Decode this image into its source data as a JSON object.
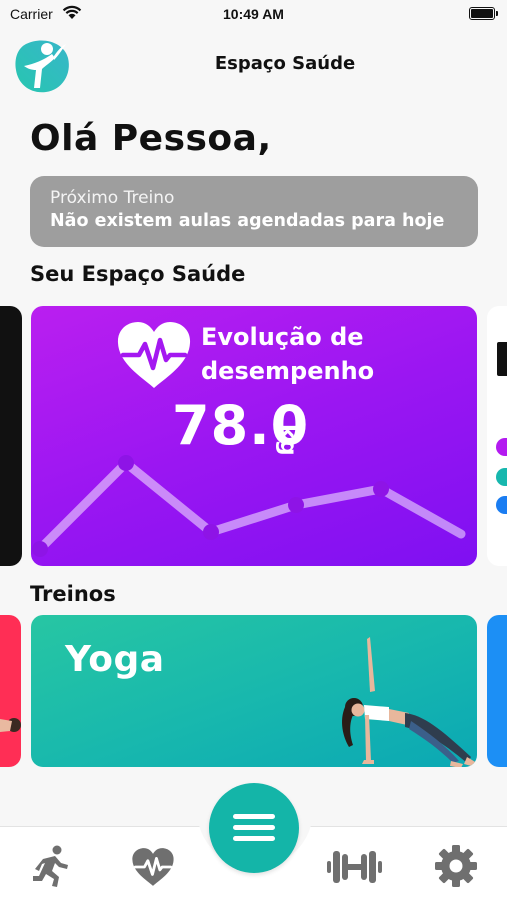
{
  "status_bar": {
    "carrier": "Carrier",
    "time": "10:49 AM"
  },
  "header": {
    "title": "Espaço Saúde"
  },
  "greeting": "Olá Pessoa,",
  "next_workout": {
    "label": "Próximo Treino",
    "message": "Não existem aulas agendadas para hoje"
  },
  "sections": {
    "space": "Seu Espaço Saúde",
    "workouts": "Treinos"
  },
  "performance_card": {
    "title_line1": "Evolução de",
    "title_line2": "desempenho",
    "value": "78.0",
    "unit": "kg",
    "icon": "heart-pulse-icon"
  },
  "workout_card": {
    "title": "Yoga",
    "image": "yoga-pose"
  },
  "tabbar": {
    "items": [
      {
        "icon": "running-icon",
        "selected": false
      },
      {
        "icon": "heart-pulse-icon",
        "selected": false
      },
      {
        "icon": "menu-icon",
        "selected": true
      },
      {
        "icon": "dumbbell-icon",
        "selected": false
      },
      {
        "icon": "gear-icon",
        "selected": false
      }
    ]
  },
  "colors": {
    "accent": "#14b5a8",
    "performance_card": "#9a16f2",
    "yoga_card": "#17b7ae",
    "next_box": "#9e9e9e",
    "tab_icon": "#6f6f6f"
  }
}
